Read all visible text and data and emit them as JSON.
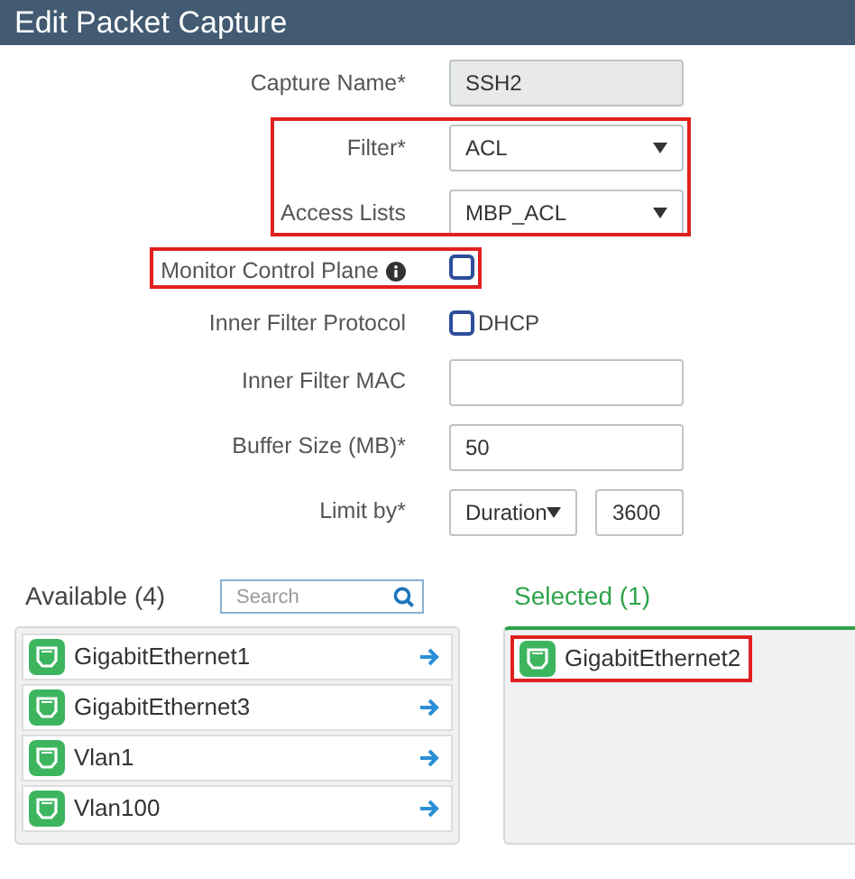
{
  "window": {
    "title": "Edit Packet Capture"
  },
  "form": [
    {
      "highlighted": false,
      "rows": [
        {
          "label": "Capture Name*",
          "kind": "text",
          "value": "SSH2",
          "disabled": true
        }
      ]
    },
    {
      "highlighted": true,
      "rows": [
        {
          "label": "Filter*",
          "kind": "select",
          "value": "ACL"
        },
        {
          "label": "Access Lists",
          "kind": "select",
          "value": "MBP_ACL"
        }
      ]
    },
    {
      "highlighted": true,
      "rows": [
        {
          "label": "Monitor Control Plane",
          "kind": "checkbox",
          "info": true,
          "checked": false
        }
      ]
    },
    {
      "highlighted": false,
      "rows": [
        {
          "label": "Inner Filter Protocol",
          "kind": "option",
          "option": "DHCP",
          "checked": false
        },
        {
          "label": "Inner Filter MAC",
          "kind": "text"
        },
        {
          "label": "Buffer Size (MB)*",
          "kind": "text",
          "value": "50"
        },
        {
          "label": "Limit by*",
          "kind": "select-number",
          "value": "Duration",
          "number": "3600"
        }
      ]
    }
  ],
  "available": {
    "title": "Available (4)",
    "search": {
      "placeholder": "Search"
    },
    "items": [
      {
        "name": "GigabitEthernet1"
      },
      {
        "name": "GigabitEthernet3"
      },
      {
        "name": "Vlan1"
      },
      {
        "name": "Vlan100"
      }
    ]
  },
  "selected": {
    "title": "Selected (1)",
    "items": [
      {
        "name": "GigabitEthernet2",
        "highlighted": true
      }
    ]
  }
}
